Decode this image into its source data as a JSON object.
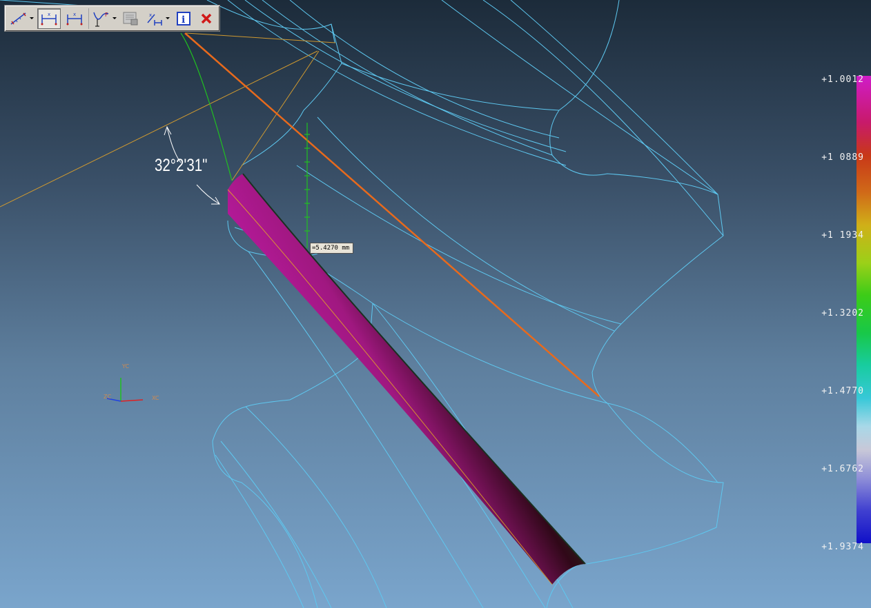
{
  "toolbar": {
    "items": [
      {
        "name": "measure-distance-tool",
        "dropdown": true
      },
      {
        "name": "horizontal-dimension-tool",
        "pressed": true
      },
      {
        "name": "vertical-dimension-tool",
        "pressed": false
      },
      {
        "name": "curve-analysis-tool",
        "dropdown": true
      },
      {
        "name": "report-tool",
        "disabled": true
      },
      {
        "name": "dimension-options-tool",
        "dropdown": true
      },
      {
        "name": "info-icon"
      },
      {
        "name": "close-icon"
      }
    ]
  },
  "annotations": {
    "angle": "32°2'31\"",
    "distance": "=5.4270 mm"
  },
  "axis_triad": {
    "labels": [
      "YC",
      "ZC",
      "XC"
    ],
    "colors": {
      "x": "#e02020",
      "y": "#20c020",
      "z": "#2040e0"
    }
  },
  "legend": {
    "labels": [
      "+1.0012",
      "+1 0889",
      "+1 1934",
      "+1.3202",
      "+1.4770",
      "+1.6762",
      "+1.9374"
    ],
    "gradient_top_color": "#d01cc8",
    "gradient_bottom_color": "#1010c8"
  },
  "colors": {
    "wireframe": "#5ec8f0",
    "measure_line": "#e86a1c",
    "construction_line": "#d09a30",
    "green_measure": "#20c020"
  }
}
